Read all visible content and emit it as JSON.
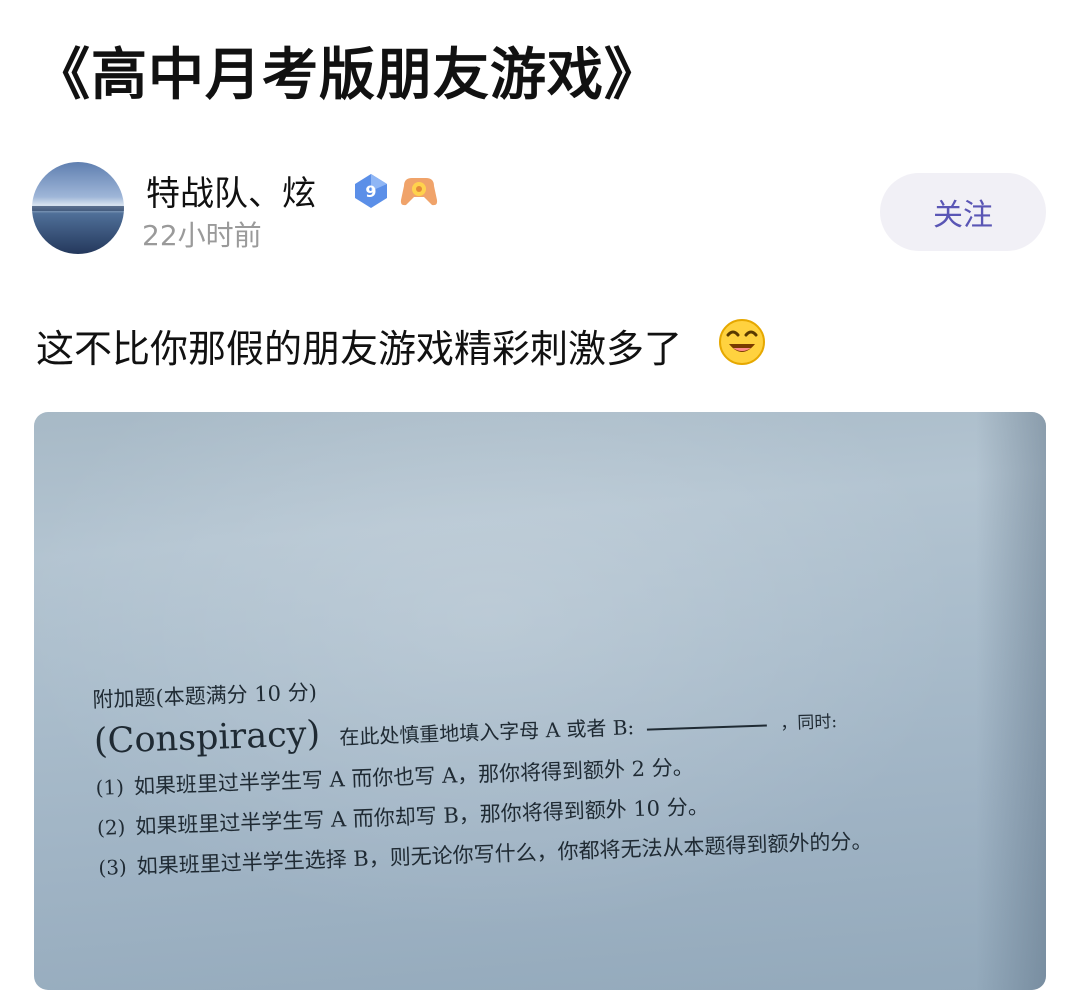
{
  "post": {
    "title": "《高中月考版朋友游戏》",
    "author": {
      "name": "特战队、炫",
      "level": "9",
      "time": "22小时前"
    },
    "follow_label": "关注",
    "text": "这不比你那假的朋友游戏精彩刺激多了",
    "emoji": "laughing-emoji-icon"
  },
  "photo": {
    "heading": "附加题(本题满分 10 分)",
    "question_word": "(Conspiracy)",
    "prompt": "在此处慎重地填入字母 A 或者 B:",
    "simultaneous": "，同时:",
    "rules": [
      {
        "index": "(1)",
        "text": "如果班里过半学生写 A 而你也写 A，那你将得到额外 2 分。"
      },
      {
        "index": "(2)",
        "text": "如果班里过半学生写 A 而你却写 B，那你将得到额外 10 分。"
      },
      {
        "index": "(3)",
        "text": "如果班里过半学生选择 B，则无论你写什么，你都将无法从本题得到额外的分。"
      }
    ]
  },
  "colors": {
    "follow_text": "#5a56b5",
    "follow_bg": "#f1f0f6",
    "time": "#9a9a9a",
    "level_badge": "#5b8fe8"
  }
}
